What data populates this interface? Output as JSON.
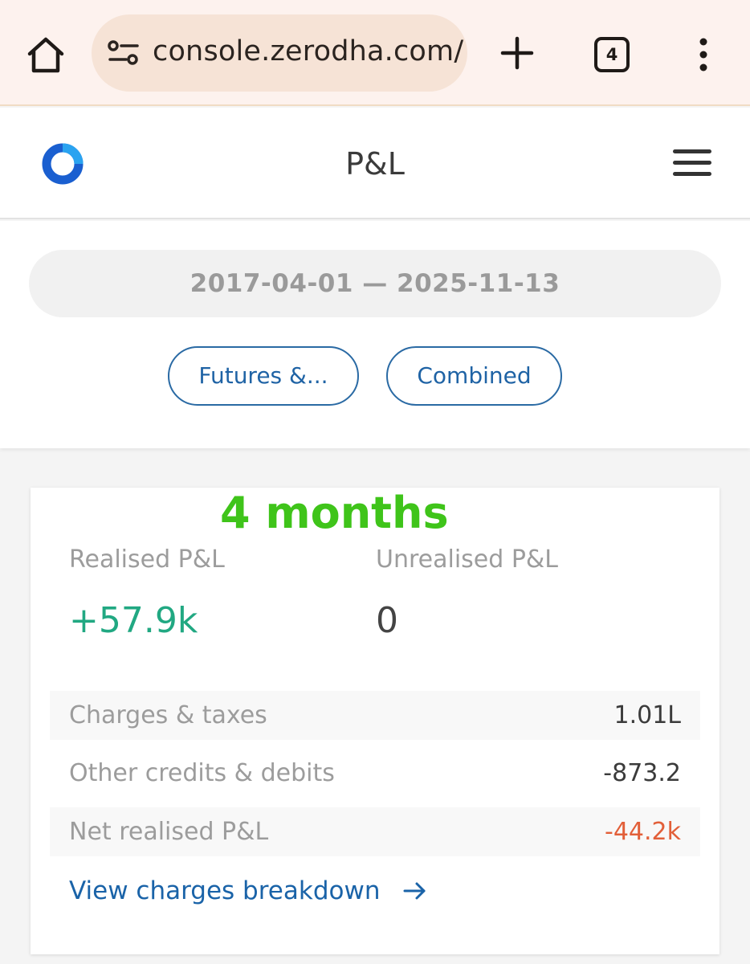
{
  "browser": {
    "url": "console.zerodha.com/",
    "tab_count": "4"
  },
  "header": {
    "title": "P&L"
  },
  "filters": {
    "date_range": "2017-04-01  —  2025-11-13",
    "segment": "Futures &...",
    "pnl_type": "Combined"
  },
  "summary": {
    "annotation": "4 months",
    "realised_label": "Realised P&L",
    "realised_value": "+57.9k",
    "unrealised_label": "Unrealised P&L",
    "unrealised_value": "0",
    "rows": [
      {
        "label": "Charges & taxes",
        "value": "1.01L"
      },
      {
        "label": "Other credits & debits",
        "value": "-873.2"
      },
      {
        "label": "Net realised P&L",
        "value": "-44.2k"
      }
    ],
    "breakdown_link": "View charges breakdown"
  },
  "colors": {
    "accent": "#1f63a5",
    "profit": "#21a882",
    "loss": "#e25f39",
    "annotation": "#3fc41a",
    "logo": "#1a5fd0"
  },
  "icons": {
    "home": "home-icon",
    "site_settings": "site-settings-icon",
    "new_tab": "plus-icon",
    "menu": "more-vert-icon",
    "app_menu": "hamburger-icon",
    "link_arrow": "arrow-right-icon"
  }
}
